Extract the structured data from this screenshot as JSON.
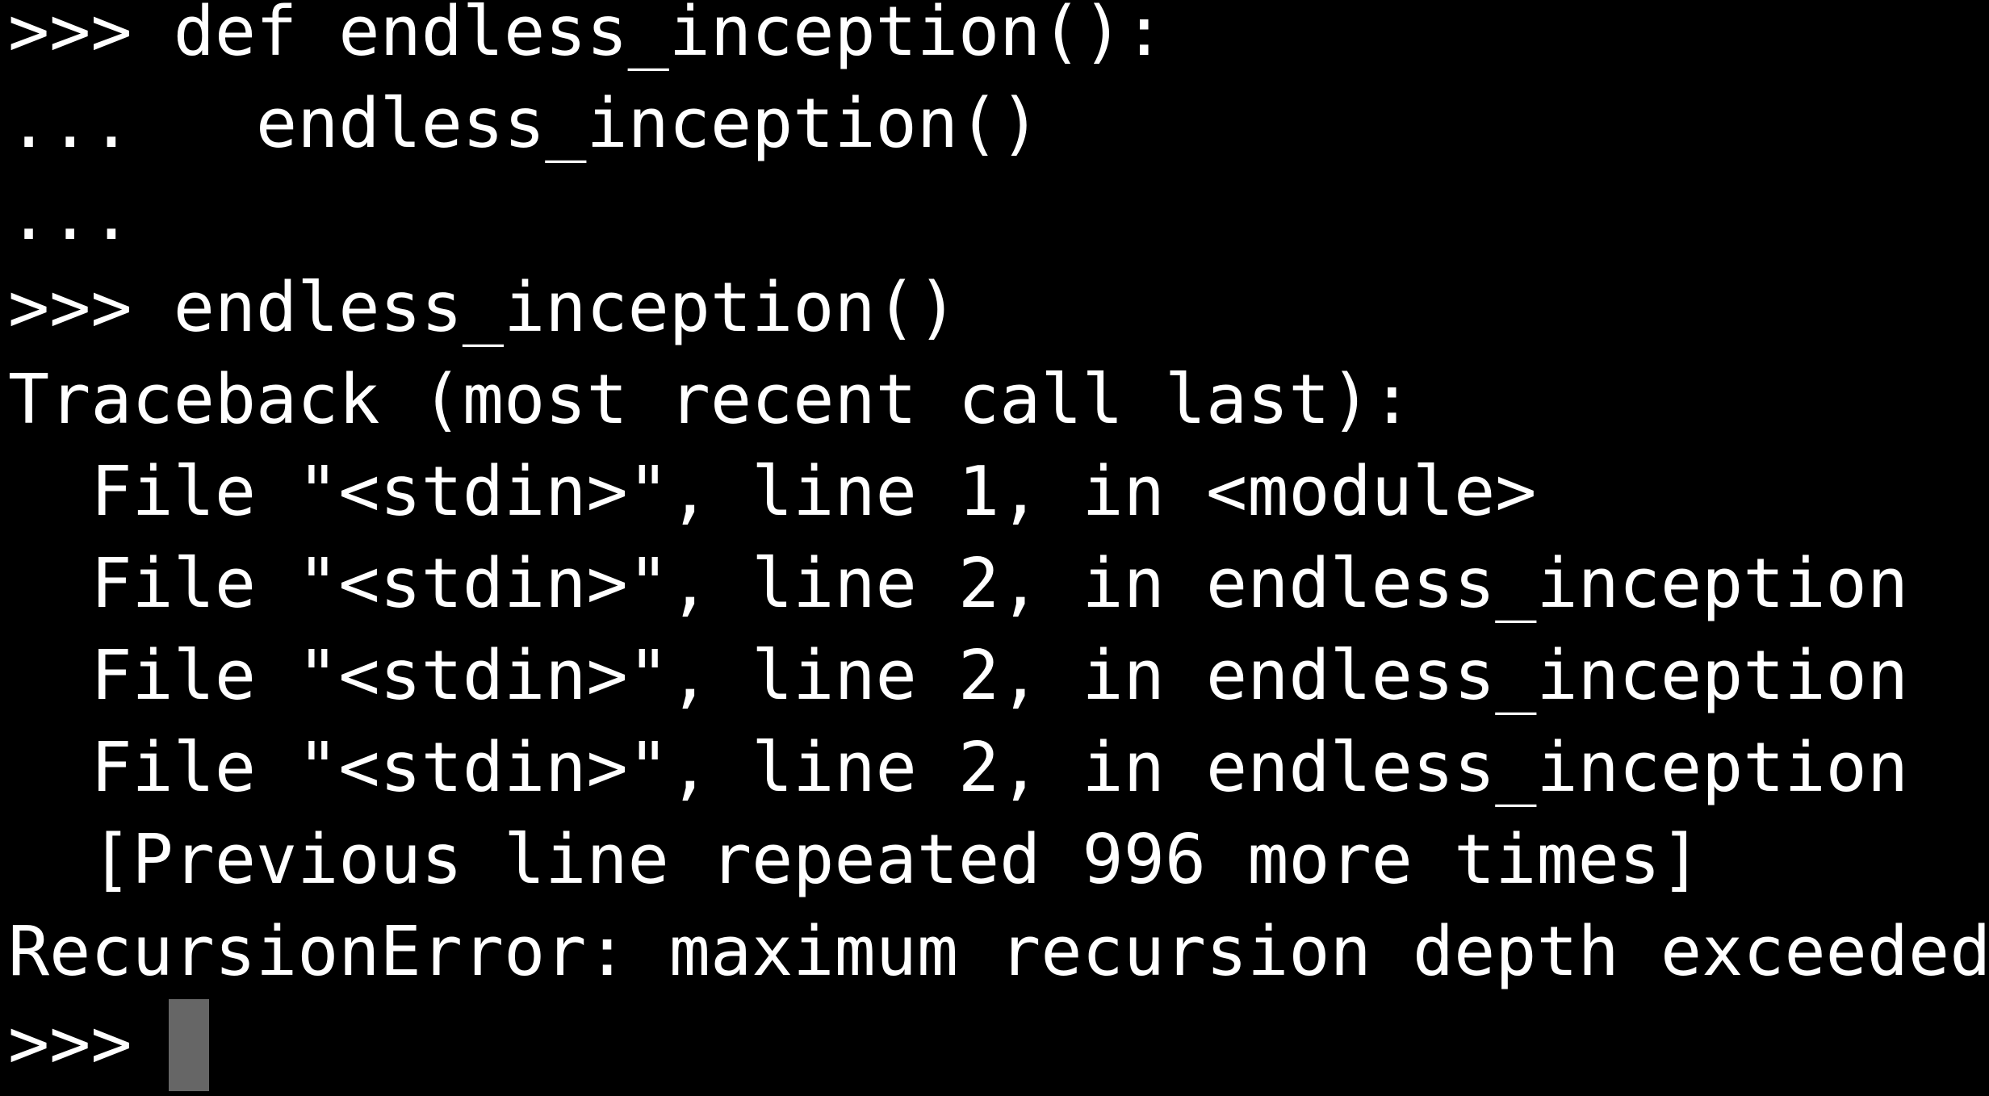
{
  "terminal": {
    "background_color": "#000000",
    "text_color": "#ffffff",
    "cursor_color": "#666666",
    "lines": [
      ">>> def endless_inception():",
      "...   endless_inception()",
      "...",
      ">>> endless_inception()",
      "Traceback (most recent call last):",
      "  File \"<stdin>\", line 1, in <module>",
      "  File \"<stdin>\", line 2, in endless_inception",
      "  File \"<stdin>\", line 2, in endless_inception",
      "  File \"<stdin>\", line 2, in endless_inception",
      "  [Previous line repeated 996 more times]",
      "RecursionError: maximum recursion depth exceeded",
      ">>> "
    ]
  }
}
